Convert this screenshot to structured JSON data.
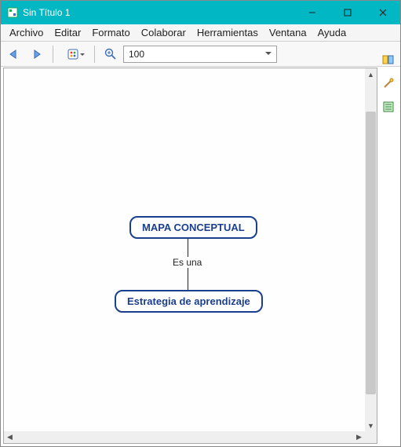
{
  "window": {
    "title": "Sin Título 1"
  },
  "menu": {
    "items": [
      "Archivo",
      "Editar",
      "Formato",
      "Colaborar",
      "Herramientas",
      "Ventana",
      "Ayuda"
    ]
  },
  "toolbar": {
    "zoom_value": "100"
  },
  "icons": {
    "back": "back-arrow-icon",
    "forward": "forward-arrow-icon",
    "style": "style-palette-icon",
    "zoom": "magnifier-plus-icon",
    "right_tool_1": "tools-icon",
    "right_tool_2": "wand-icon",
    "right_tool_3": "list-icon"
  },
  "diagram": {
    "node1": "MAPA CONCEPTUAL",
    "link_label": "Es una",
    "node2": "Estrategia de aprendizaje"
  },
  "chart_data": {
    "type": "concept-map",
    "nodes": [
      {
        "id": "n1",
        "label": "MAPA CONCEPTUAL"
      },
      {
        "id": "n2",
        "label": "Estrategia de aprendizaje"
      }
    ],
    "links": [
      {
        "from": "n1",
        "to": "n2",
        "label": "Es una"
      }
    ]
  }
}
